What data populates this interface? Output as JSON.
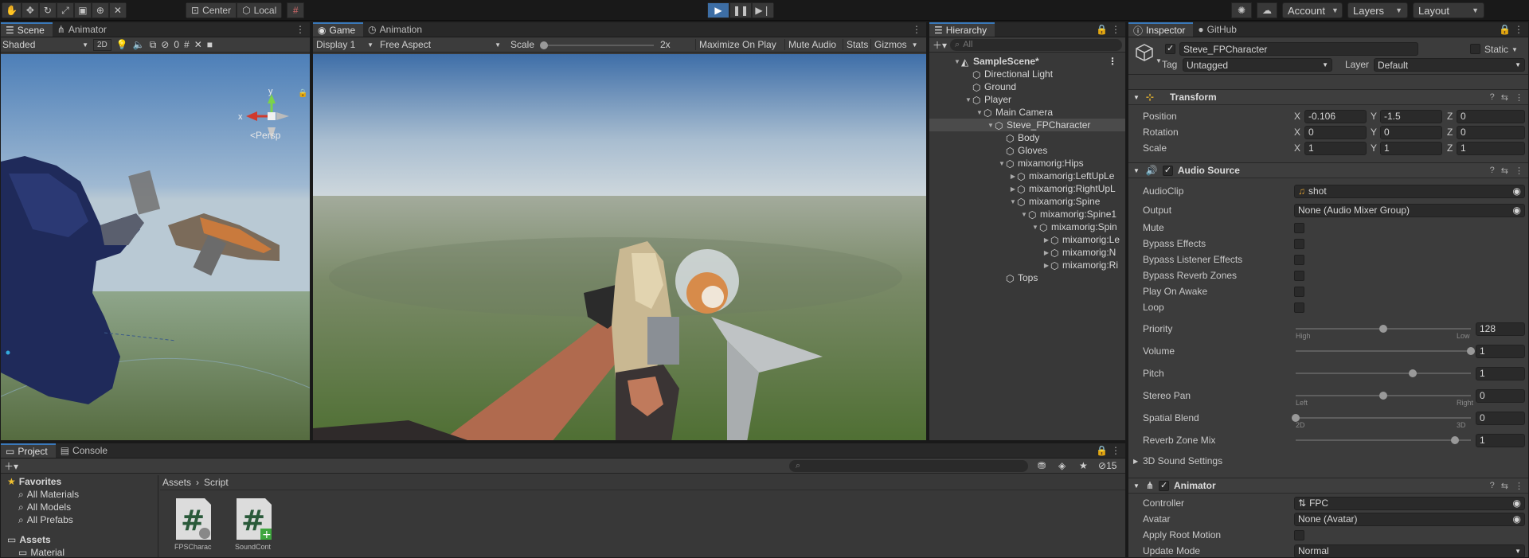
{
  "toolbar": {
    "pivot_label": "Center",
    "space_label": "Local",
    "account_label": "Account",
    "layers_label": "Layers",
    "layout_label": "Layout"
  },
  "scene": {
    "tab_scene": "Scene",
    "tab_animator": "Animator",
    "shading_mode": "Shaded",
    "mode_2d": "2D",
    "hidden_count": "0",
    "persp_label": "Persp",
    "axis_x": "x",
    "axis_y": "y"
  },
  "game": {
    "tab_game": "Game",
    "tab_animation": "Animation",
    "display": "Display 1",
    "aspect": "Free Aspect",
    "scale_label": "Scale",
    "scale_value": "2x",
    "maximize": "Maximize On Play",
    "mute": "Mute Audio",
    "stats": "Stats",
    "gizmos": "Gizmos"
  },
  "hierarchy": {
    "tab": "Hierarchy",
    "search_placeholder": "All",
    "rows": [
      {
        "label": "SampleScene*",
        "bold": true
      },
      {
        "label": "Directional Light"
      },
      {
        "label": "Ground"
      },
      {
        "label": "Player"
      },
      {
        "label": "Main Camera"
      },
      {
        "label": "Steve_FPCharacter",
        "selected": true
      },
      {
        "label": "Body"
      },
      {
        "label": "Gloves"
      },
      {
        "label": "mixamorig:Hips"
      },
      {
        "label": "mixamorig:LeftUpLe"
      },
      {
        "label": "mixamorig:RightUpL"
      },
      {
        "label": "mixamorig:Spine"
      },
      {
        "label": "mixamorig:Spine1"
      },
      {
        "label": "mixamorig:Spin"
      },
      {
        "label": "mixamorig:Le"
      },
      {
        "label": "mixamorig:N"
      },
      {
        "label": "mixamorig:Ri"
      },
      {
        "label": "Tops"
      }
    ]
  },
  "project": {
    "tab_project": "Project",
    "tab_console": "Console",
    "favorites_label": "Favorites",
    "favorites": [
      "All Materials",
      "All Models",
      "All Prefabs"
    ],
    "assets_label": "Assets",
    "assets_child": "Material",
    "breadcrumb_root": "Assets",
    "breadcrumb_leaf": "Script",
    "hidden_count": "15",
    "files": [
      "FPSCharac",
      "SoundCont"
    ]
  },
  "inspector": {
    "tab_inspector": "Inspector",
    "tab_github": "GitHub",
    "object_name": "Steve_FPCharacter",
    "static_label": "Static",
    "tag_label": "Tag",
    "tag_value": "Untagged",
    "layer_label": "Layer",
    "layer_value": "Default",
    "transform": {
      "title": "Transform",
      "position_label": "Position",
      "rotation_label": "Rotation",
      "scale_label": "Scale",
      "position": [
        "-0.106",
        "-1.5",
        "0"
      ],
      "rotation": [
        "0",
        "0",
        "0"
      ],
      "scale": [
        "1",
        "1",
        "1"
      ]
    },
    "audio": {
      "title": "Audio Source",
      "audioclip_label": "AudioClip",
      "audioclip_value": "shot",
      "output_label": "Output",
      "output_value": "None (Audio Mixer Group)",
      "toggles": [
        {
          "label": "Mute",
          "value": false
        },
        {
          "label": "Bypass Effects",
          "value": false
        },
        {
          "label": "Bypass Listener Effects",
          "value": false
        },
        {
          "label": "Bypass Reverb Zones",
          "value": false
        },
        {
          "label": "Play On Awake",
          "value": false
        },
        {
          "label": "Loop",
          "value": false
        }
      ],
      "sliders": [
        {
          "label": "Priority",
          "value": "128",
          "fraction": 0.5,
          "min_label": "High",
          "max_label": "Low"
        },
        {
          "label": "Volume",
          "value": "1",
          "fraction": 1.0
        },
        {
          "label": "Pitch",
          "value": "1",
          "fraction": 0.67
        },
        {
          "label": "Stereo Pan",
          "value": "0",
          "fraction": 0.5,
          "min_label": "Left",
          "max_label": "Right"
        },
        {
          "label": "Spatial Blend",
          "value": "0",
          "fraction": 0.0,
          "min_label": "2D",
          "max_label": "3D"
        },
        {
          "label": "Reverb Zone Mix",
          "value": "1",
          "fraction": 0.91
        }
      ],
      "sound_settings_label": "3D Sound Settings"
    },
    "animator": {
      "title": "Animator",
      "controller_label": "Controller",
      "controller_value": "FPC",
      "avatar_label": "Avatar",
      "avatar_value": "None (Avatar)",
      "root_motion_label": "Apply Root Motion",
      "update_mode_label": "Update Mode",
      "update_mode_value": "Normal"
    }
  }
}
